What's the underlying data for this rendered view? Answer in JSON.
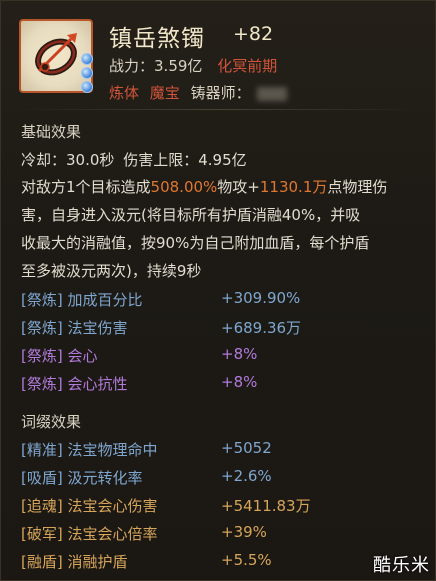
{
  "header": {
    "name": "镇岳煞镯",
    "level": "+82",
    "power_label": "战力：",
    "power_value": "3.59亿",
    "realm": "化冥前期",
    "tag1": "炼体",
    "tag2": "魔宝",
    "forger_label": "铸器师："
  },
  "basic": {
    "title": "基础效果",
    "cooldown_label": "冷却：",
    "cooldown_value": "30.0秒",
    "cap_label": "伤害上限：",
    "cap_value": "4.95亿",
    "desc1_a": "对敌方1个目标造成",
    "desc1_b": "508.00%",
    "desc1_c": "物攻+",
    "desc1_d": "1130.1万",
    "desc1_e": "点物理伤",
    "desc2": "害，自身进入汲元(将目标所有护盾消融40%，并吸",
    "desc3": "收最大的消融值，按90%为自己附加血盾，每个护盾",
    "desc4": "至多被汲元两次)，持续9秒"
  },
  "refine": [
    {
      "tag": "[祭炼]",
      "name": "加成百分比",
      "value": "+309.90%",
      "color": "blue"
    },
    {
      "tag": "[祭炼]",
      "name": "法宝伤害",
      "value": "+689.36万",
      "color": "blue"
    },
    {
      "tag": "[祭炼]",
      "name": "会心",
      "value": "+8%",
      "color": "purple"
    },
    {
      "tag": "[祭炼]",
      "name": "会心抗性",
      "value": "+8%",
      "color": "purple"
    }
  ],
  "affix": {
    "title": "词缀效果",
    "items": [
      {
        "tag": "[精准]",
        "name": "法宝物理命中",
        "value": "+5052",
        "color": "blue"
      },
      {
        "tag": "[吸盾]",
        "name": "汲元转化率",
        "value": "+2.6%",
        "color": "blue"
      },
      {
        "tag": "[追魂]",
        "name": "法宝会心伤害",
        "value": "+5411.83万",
        "color": "gold"
      },
      {
        "tag": "[破军]",
        "name": "法宝会心倍率",
        "value": "+39%",
        "color": "gold"
      },
      {
        "tag": "[融盾]",
        "name": "消融护盾",
        "value": "+5.5%",
        "color": "gold"
      }
    ]
  },
  "watermark": "酷乐米"
}
